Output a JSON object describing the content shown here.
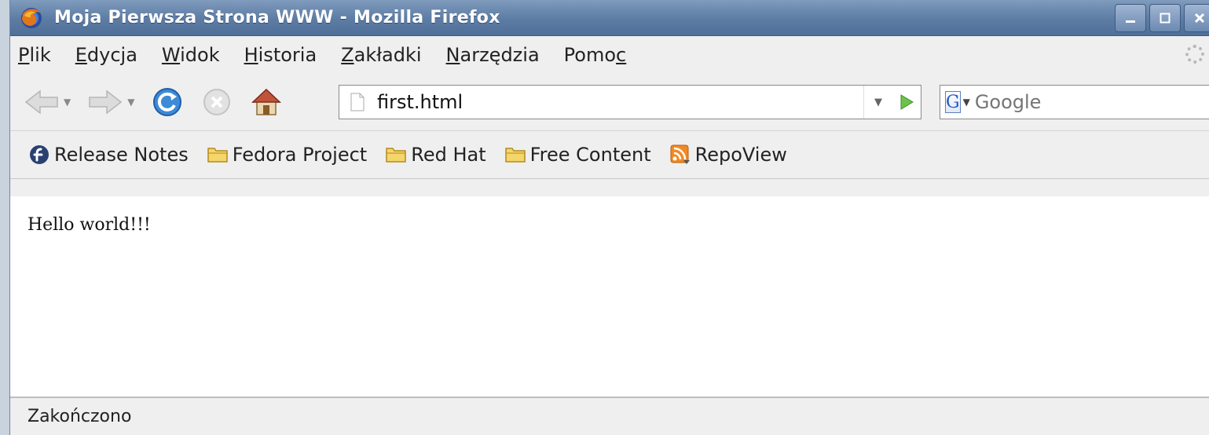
{
  "window": {
    "title": "Moja Pierwsza Strona WWW - Mozilla Firefox"
  },
  "menu": [
    {
      "key": "P",
      "rest": "lik"
    },
    {
      "key": "E",
      "rest": "dycja"
    },
    {
      "key": "W",
      "rest": "idok"
    },
    {
      "key": "H",
      "rest": "istoria"
    },
    {
      "key": "Z",
      "rest": "akładki"
    },
    {
      "key": "N",
      "rest": "arzędzia"
    },
    {
      "pre": "Pomo",
      "key": "c"
    }
  ],
  "navbar": {
    "url": "first.html",
    "search_placeholder": "Google",
    "search_engine_letter": "G"
  },
  "bookmarks": [
    {
      "label": "Release Notes",
      "icon": "fedora-icon"
    },
    {
      "label": "Fedora Project",
      "icon": "folder-icon"
    },
    {
      "label": "Red Hat",
      "icon": "folder-icon"
    },
    {
      "label": "Free Content",
      "icon": "folder-icon"
    },
    {
      "label": "RepoView",
      "icon": "rss-icon"
    }
  ],
  "content": {
    "text": "Hello world!!!"
  },
  "status": {
    "text": "Zakończono"
  }
}
